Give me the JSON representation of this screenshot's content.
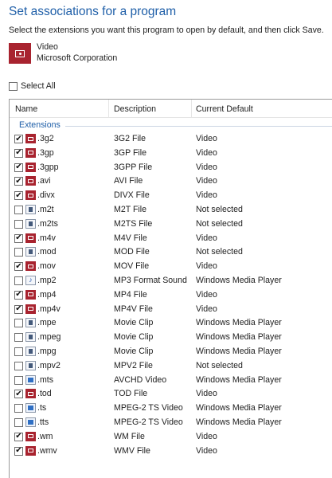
{
  "title": "Set associations for a program",
  "instructions": "Select the extensions you want this program to open by default, and then click Save.",
  "program": {
    "name": "Video",
    "company": "Microsoft Corporation"
  },
  "select_all_label": "Select All",
  "columns": {
    "name": "Name",
    "description": "Description",
    "current_default": "Current Default"
  },
  "group_label": "Extensions",
  "rows": [
    {
      "ext": ".3g2",
      "desc": "3G2 File",
      "def": "Video",
      "checked": true,
      "icon": "video-file-icon"
    },
    {
      "ext": ".3gp",
      "desc": "3GP File",
      "def": "Video",
      "checked": true,
      "icon": "video-file-icon"
    },
    {
      "ext": ".3gpp",
      "desc": "3GPP File",
      "def": "Video",
      "checked": true,
      "icon": "video-file-icon"
    },
    {
      "ext": ".avi",
      "desc": "AVI File",
      "def": "Video",
      "checked": true,
      "icon": "video-file-icon"
    },
    {
      "ext": ".divx",
      "desc": "DIVX File",
      "def": "Video",
      "checked": true,
      "icon": "video-file-icon"
    },
    {
      "ext": ".m2t",
      "desc": "M2T File",
      "def": "Not selected",
      "checked": false,
      "icon": "generic-file-icon"
    },
    {
      "ext": ".m2ts",
      "desc": "M2TS File",
      "def": "Not selected",
      "checked": false,
      "icon": "generic-file-icon"
    },
    {
      "ext": ".m4v",
      "desc": "M4V File",
      "def": "Video",
      "checked": true,
      "icon": "video-file-icon"
    },
    {
      "ext": ".mod",
      "desc": "MOD File",
      "def": "Not selected",
      "checked": false,
      "icon": "generic-file-icon"
    },
    {
      "ext": ".mov",
      "desc": "MOV File",
      "def": "Video",
      "checked": true,
      "icon": "video-file-icon"
    },
    {
      "ext": ".mp2",
      "desc": "MP3 Format Sound",
      "def": "Windows Media Player",
      "checked": false,
      "icon": "music-note-icon"
    },
    {
      "ext": ".mp4",
      "desc": "MP4 File",
      "def": "Video",
      "checked": true,
      "icon": "video-file-icon"
    },
    {
      "ext": ".mp4v",
      "desc": "MP4V File",
      "def": "Video",
      "checked": true,
      "icon": "video-file-icon"
    },
    {
      "ext": ".mpe",
      "desc": "Movie Clip",
      "def": "Windows Media Player",
      "checked": false,
      "icon": "generic-file-icon"
    },
    {
      "ext": ".mpeg",
      "desc": "Movie Clip",
      "def": "Windows Media Player",
      "checked": false,
      "icon": "generic-file-icon"
    },
    {
      "ext": ".mpg",
      "desc": "Movie Clip",
      "def": "Windows Media Player",
      "checked": false,
      "icon": "generic-file-icon"
    },
    {
      "ext": ".mpv2",
      "desc": "MPV2 File",
      "def": "Not selected",
      "checked": false,
      "icon": "generic-file-icon"
    },
    {
      "ext": ".mts",
      "desc": "AVCHD Video",
      "def": "Windows Media Player",
      "checked": false,
      "icon": "media-player-file-icon"
    },
    {
      "ext": ".tod",
      "desc": "TOD File",
      "def": "Video",
      "checked": true,
      "icon": "video-file-icon"
    },
    {
      "ext": ".ts",
      "desc": "MPEG-2 TS Video",
      "def": "Windows Media Player",
      "checked": false,
      "icon": "media-player-file-icon"
    },
    {
      "ext": ".tts",
      "desc": "MPEG-2 TS Video",
      "def": "Windows Media Player",
      "checked": false,
      "icon": "media-player-file-icon"
    },
    {
      "ext": ".wm",
      "desc": "WM File",
      "def": "Video",
      "checked": true,
      "icon": "video-file-icon"
    },
    {
      "ext": ".wmv",
      "desc": "WMV File",
      "def": "Video",
      "checked": true,
      "icon": "video-file-icon"
    }
  ],
  "colors": {
    "accent": "#1f5fa8",
    "video_icon": "#a8232f"
  }
}
